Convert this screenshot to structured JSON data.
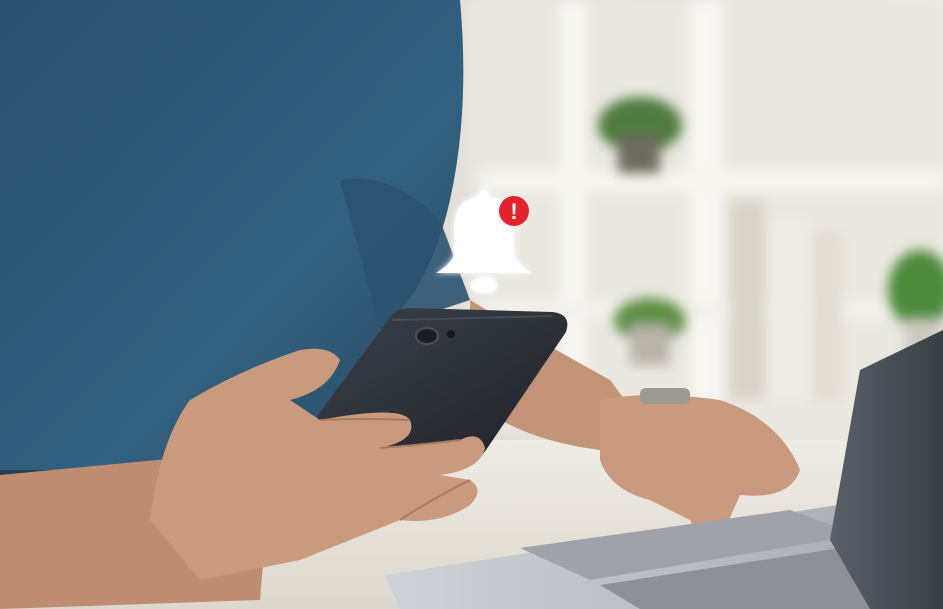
{
  "photo": {
    "subject": "person-holding-smartphone-at-laptop",
    "colors": {
      "shirt": "#2e5676",
      "wall": "#e9e6df",
      "shelf": "#f1efea",
      "desk": "#e8e4dc",
      "skin": "#c99a7e",
      "phone": "#2b2f36",
      "laptop": "#b9bcc1",
      "plant": "#4f8a3a"
    }
  },
  "notification": {
    "icon": "bell-icon",
    "badge_icon": "exclamation-icon",
    "badge_glyph": "!",
    "bell_color": "#ffffff",
    "badge_color": "#e5212b"
  }
}
